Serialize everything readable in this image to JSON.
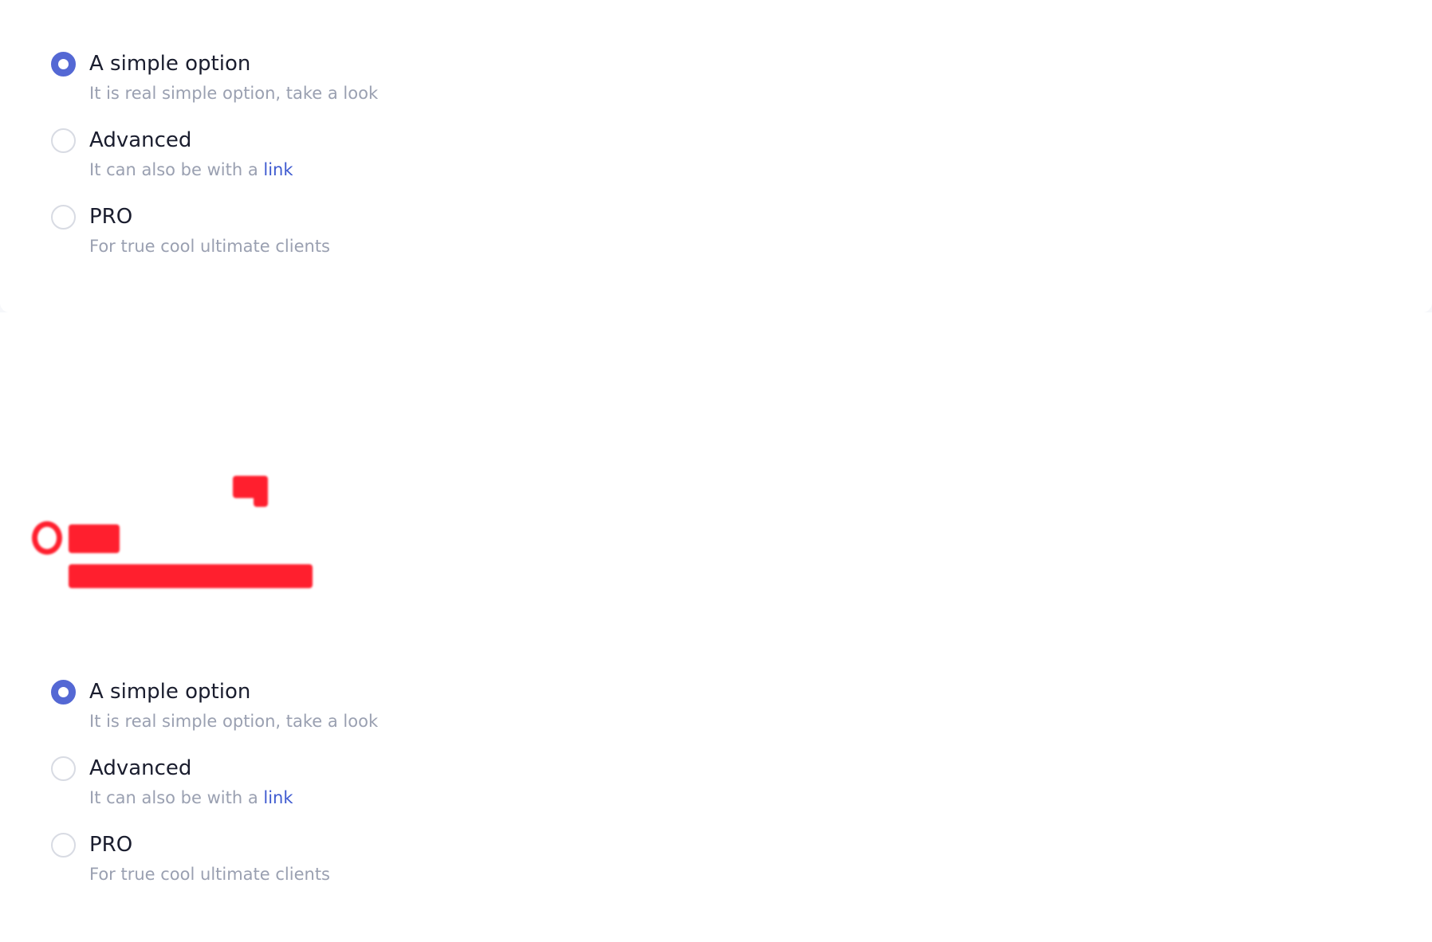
{
  "groups": [
    {
      "options": [
        {
          "label": "A simple option",
          "description": "It is real simple option, take a look",
          "checked": true
        },
        {
          "label": "Advanced",
          "description_prefix": "It can also be with a",
          "link": "link",
          "checked": false
        },
        {
          "label": "PRO",
          "description": "For true cool ultimate clients",
          "checked": false
        }
      ]
    },
    {
      "options": [
        {
          "label": "A simple option",
          "description": "It is real simple option, take a look",
          "checked": true
        },
        {
          "label": "Advanced",
          "description_prefix": "It can also be with a",
          "link": "link",
          "checked": false
        },
        {
          "label": "PRO",
          "description": "For true cool ultimate clients",
          "checked": false
        }
      ]
    }
  ],
  "colors": {
    "accent": "#5468d4",
    "link": "#3f5bd0",
    "label": "#1a1d2e",
    "description": "#9aa0b1",
    "artifact": "#ff1f2e"
  }
}
